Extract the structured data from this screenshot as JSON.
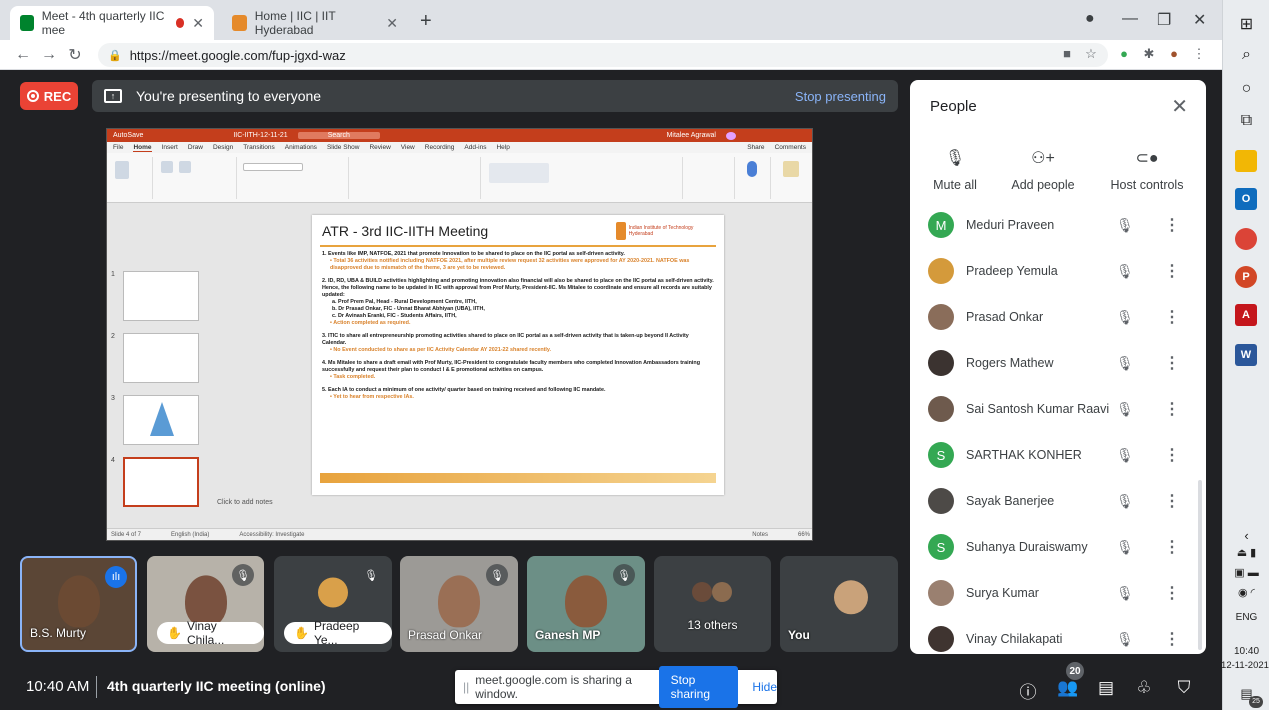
{
  "browser": {
    "tabs": [
      {
        "title": "Meet - 4th quarterly IIC mee"
      },
      {
        "title": "Home | IIC | IIT Hyderabad"
      }
    ],
    "url": "https://meet.google.com/fup-jgxd-waz"
  },
  "meet": {
    "rec_label": "REC",
    "presenting_text": "You're presenting to everyone",
    "stop_presenting_label": "Stop presenting",
    "meeting_time": "10:40 AM",
    "meeting_title": "4th quarterly IIC meeting (online)",
    "sharing_banner": {
      "text": "meet.google.com is sharing a window.",
      "stop_label": "Stop sharing",
      "hide_label": "Hide"
    },
    "participant_count": "20",
    "tiles": [
      {
        "name": "B.S. Murty"
      },
      {
        "name": "Vinay Chila..."
      },
      {
        "name": "Pradeep Ye..."
      },
      {
        "name": "Prasad Onkar"
      },
      {
        "name": "Ganesh MP"
      },
      {
        "name": "13 others"
      },
      {
        "name": "You"
      }
    ]
  },
  "people_panel": {
    "title": "People",
    "actions": [
      {
        "label": "Mute all"
      },
      {
        "label": "Add people"
      },
      {
        "label": "Host controls"
      }
    ],
    "people": [
      {
        "name": "Meduri Praveen",
        "initial": "M"
      },
      {
        "name": "Pradeep Yemula",
        "initial": ""
      },
      {
        "name": "Prasad Onkar",
        "initial": ""
      },
      {
        "name": "Rogers Mathew",
        "initial": ""
      },
      {
        "name": "Sai Santosh Kumar Raavi",
        "initial": ""
      },
      {
        "name": "SARTHAK KONHER",
        "initial": "S"
      },
      {
        "name": "Sayak Banerjee",
        "initial": ""
      },
      {
        "name": "Suhanya Duraiswamy",
        "initial": "S"
      },
      {
        "name": "Surya Kumar",
        "initial": ""
      },
      {
        "name": "Vinay Chilakapati",
        "initial": ""
      }
    ]
  },
  "powerpoint": {
    "title_bar": {
      "autosave": "AutoSave",
      "file_name": "IIC-IITH-12-11-21",
      "search": "Search",
      "user": "Mitalee Agrawal"
    },
    "menu": [
      "File",
      "Home",
      "Insert",
      "Draw",
      "Design",
      "Transitions",
      "Animations",
      "Slide Show",
      "Review",
      "View",
      "Recording",
      "Add-ins",
      "Help"
    ],
    "share_label": "Share",
    "comments_label": "Comments",
    "notes_placeholder": "Click to add notes",
    "status": {
      "slide": "Slide 4 of 7",
      "language": "English (India)",
      "accessibility": "Accessibility: Investigate",
      "notes": "Notes",
      "zoom": "66%"
    },
    "slide": {
      "title": "ATR - 3rd IIC-IITH Meeting",
      "logo_text": "Indian Institute of Technology Hyderabad",
      "items": [
        {
          "text": "1.  Events like IMP, NATFOE, 2021 that promote Innovation to be shared to place on the IIC portal as self-driven activity.",
          "sub": "Total 36 activities notified including NATFOE 2021, after multiple review request 32 activities were approved for AY 2020-2021. NATFOE was disapproved due to mismatch of the theme, 3 are yet to be reviewed."
        },
        {
          "text": "2.  ID, RD, UBA & BUILD activities highlighting and promoting innovation also financial will also be shared to place on the IIC portal as self-driven activity. Hence, the following name to be updated in IIC with approval from Prof Murty, President-IIC. Ms Mitalee to coordinate and ensure all records are suitably updated:",
          "list": [
            "a.   Prof Prem Pal, Head - Rural Development Centre, IITH,",
            "b.   Dr Prasad Onkar, FIC - Unnat Bharat Abhiyan (UBA), IITH,",
            "c.   Dr Avinash Eranki, FIC - Students Affairs, IITH,"
          ],
          "sub": "Action completed as required."
        },
        {
          "text": "3.  ITIC to share all entrepreneurship promoting activities shared to place on IIC portal as a self-driven activity that is taken-up beyond II Activity Calendar.",
          "sub": "No Event conducted to share as per IIC Activity Calendar AY 2021-22 shared recently."
        },
        {
          "text": "4.  Ms Mitalee to share a draft email with Prof Murty, IIC-President to congratulate faculty members who completed Innovation Ambassadors training successfully and request their plan to conduct I & E promotional activities on campus.",
          "sub": "Task completed."
        },
        {
          "text": "5.  Each IA to conduct a minimum of one activity/ quarter based on training received and following IIC mandate.",
          "sub": "Yet to hear from respective IAs."
        }
      ]
    }
  },
  "taskbar": {
    "language": "ENG",
    "time": "10:40",
    "date": "12-11-2021",
    "notifications": "25"
  }
}
